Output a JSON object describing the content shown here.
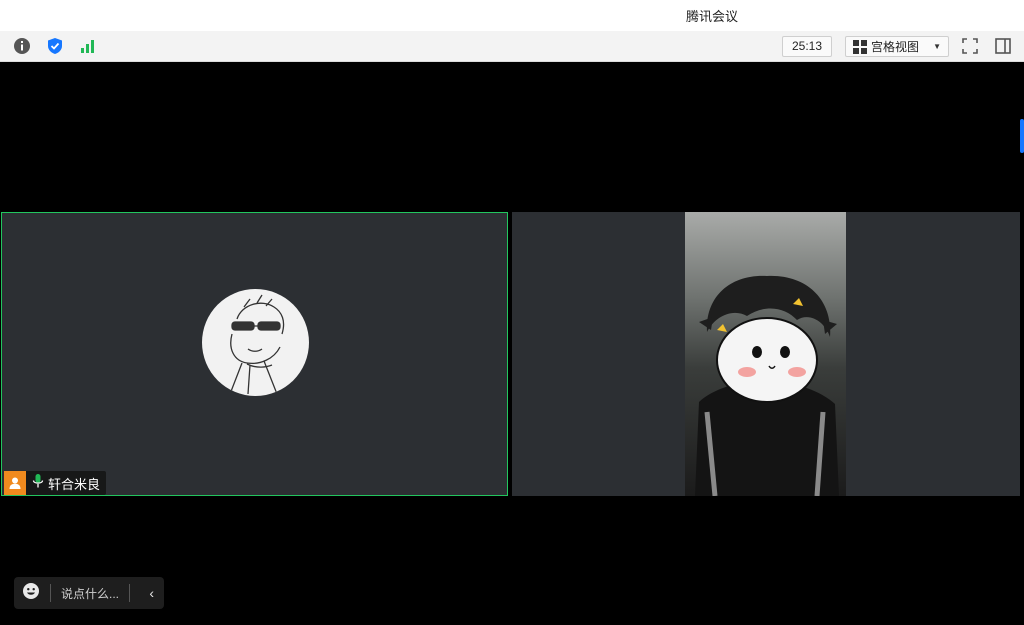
{
  "window": {
    "title": "腾讯会议"
  },
  "toolbar": {
    "timer": "25:13",
    "view_mode_label": "宫格视图",
    "icons": [
      "info-icon",
      "shield-icon",
      "signal-icon",
      "fullscreen-icon",
      "side-panel-icon"
    ]
  },
  "participants": [
    {
      "name": "轩合米良",
      "role": "host",
      "mic": "on",
      "video": "off"
    },
    {
      "name": "",
      "video": "on"
    }
  ],
  "chat": {
    "placeholder": "说点什么..."
  },
  "colors": {
    "active_speaker": "#22c55e",
    "host_badge": "#f08a1e",
    "security": "#1677ff",
    "signal": "#21b856"
  }
}
